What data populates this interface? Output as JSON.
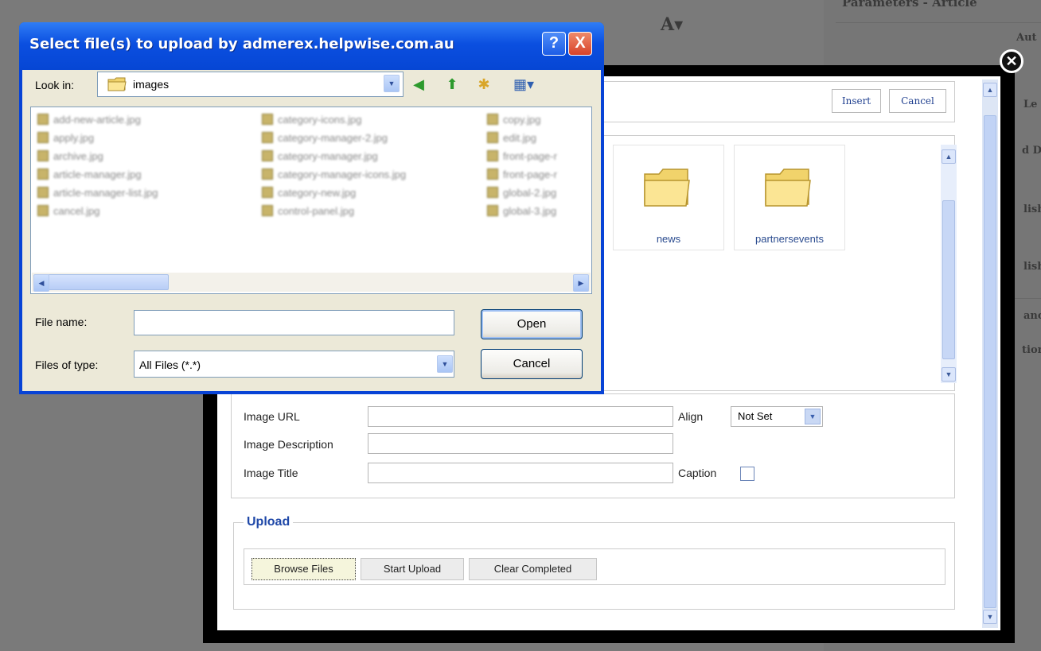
{
  "background": {
    "panel_title": "Parameters - Article",
    "side_labels": [
      "Aut",
      "Le",
      "d D",
      "lish",
      "lish",
      "anc",
      "tion"
    ]
  },
  "modal": {
    "insert_label": "Insert",
    "cancel_label": "Cancel",
    "folders": [
      {
        "name": "news"
      },
      {
        "name": "partnersevents"
      }
    ],
    "properties": {
      "image_url_label": "Image URL",
      "image_description_label": "Image Description",
      "image_title_label": "Image Title",
      "align_label": "Align",
      "align_value": "Not Set",
      "caption_label": "Caption"
    },
    "upload": {
      "legend": "Upload",
      "browse_label": "Browse Files",
      "start_label": "Start Upload",
      "clear_label": "Clear Completed"
    }
  },
  "dialog": {
    "title": "Select file(s) to upload by admerex.helpwise.com.au",
    "help_label": "?",
    "close_label": "X",
    "look_in_label": "Look in:",
    "look_in_value": "images",
    "files": [
      [
        "add-new-article.jpg",
        "apply.jpg",
        "archive.jpg",
        "article-manager.jpg",
        "article-manager-list.jpg",
        "cancel.jpg"
      ],
      [
        "category-icons.jpg",
        "category-manager-2.jpg",
        "category-manager.jpg",
        "category-manager-icons.jpg",
        "category-new.jpg",
        "control-panel.jpg"
      ],
      [
        "copy.jpg",
        "edit.jpg",
        "front-page-r",
        "front-page-r",
        "global-2.jpg",
        "global-3.jpg"
      ]
    ],
    "file_name_label": "File name:",
    "file_name_value": "",
    "files_of_type_label": "Files of type:",
    "files_of_type_value": "All Files (*.*)",
    "open_label": "Open",
    "cancel_label": "Cancel"
  },
  "colors": {
    "xp_title": "#0b4fe0",
    "xp_close": "#e0492c",
    "modal_frame": "#000000",
    "link_blue": "#1f48a8"
  }
}
